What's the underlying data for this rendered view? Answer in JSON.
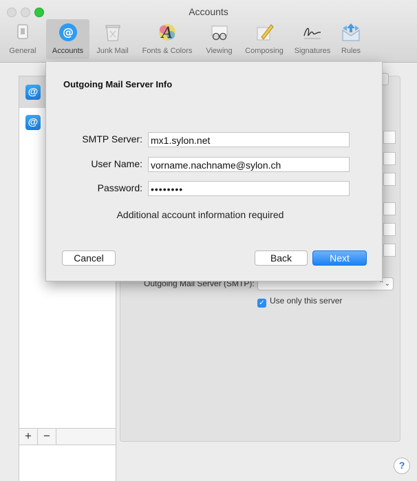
{
  "window": {
    "title": "Accounts"
  },
  "toolbar": {
    "items": [
      {
        "label": "General",
        "icon": "general-icon"
      },
      {
        "label": "Accounts",
        "icon": "at-sign-icon"
      },
      {
        "label": "Junk Mail",
        "icon": "trash-icon"
      },
      {
        "label": "Fonts & Colors",
        "icon": "font-icon"
      },
      {
        "label": "Viewing",
        "icon": "glasses-icon"
      },
      {
        "label": "Composing",
        "icon": "pencil-icon"
      },
      {
        "label": "Signatures",
        "icon": "signature-icon"
      },
      {
        "label": "Rules",
        "icon": "rules-icon"
      }
    ],
    "selected": "Accounts"
  },
  "sidebar": {
    "accounts": [
      {
        "icon": "@"
      },
      {
        "icon": "@"
      }
    ],
    "add_label": "+",
    "remove_label": "−"
  },
  "detail": {
    "smtp_label": "Outgoing Mail Server (SMTP):",
    "use_only_label": "Use only this server",
    "use_only_checked": true
  },
  "dialog": {
    "title": "Outgoing Mail Server Info",
    "fields": {
      "smtp_label": "SMTP Server:",
      "smtp_value": "mx1.sylon.net",
      "user_label": "User Name:",
      "user_value": "vorname.nachname@sylon.ch",
      "password_label": "Password:",
      "password_value": "••••••••"
    },
    "notice": "Additional account information required",
    "buttons": {
      "cancel": "Cancel",
      "back": "Back",
      "next": "Next"
    }
  },
  "help": {
    "label": "?"
  },
  "colors": {
    "accent": "#1b82f4",
    "zoom_button": "#2fc840",
    "selected_tab": "#c9c9c9"
  }
}
